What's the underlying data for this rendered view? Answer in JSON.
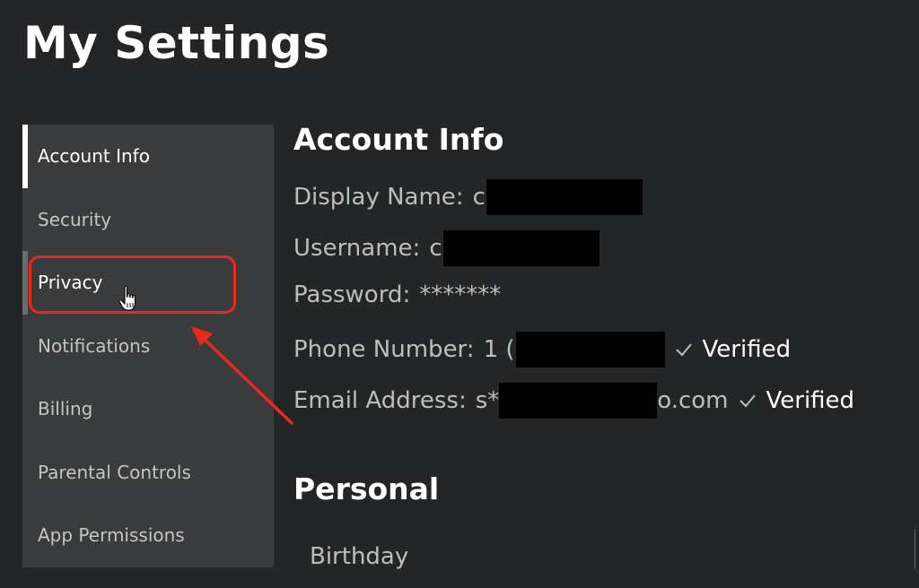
{
  "page": {
    "title": "My Settings"
  },
  "sidebar": {
    "items": [
      {
        "label": "Account Info"
      },
      {
        "label": "Security"
      },
      {
        "label": "Privacy"
      },
      {
        "label": "Notifications"
      },
      {
        "label": "Billing"
      },
      {
        "label": "Parental Controls"
      },
      {
        "label": "App Permissions"
      }
    ],
    "active": "Account Info",
    "hovered": "Privacy"
  },
  "account_info": {
    "title": "Account Info",
    "display_name": {
      "label": "Display Name:",
      "value": "c"
    },
    "username": {
      "label": "Username:",
      "value": "c"
    },
    "password": {
      "label": "Password:",
      "value": "*******"
    },
    "phone": {
      "label": "Phone Number:",
      "value": "1 (",
      "status": "Verified"
    },
    "email": {
      "label": "Email Address:",
      "value_prefix": "s*",
      "value_suffix": "o.com",
      "status": "Verified"
    }
  },
  "personal": {
    "title": "Personal",
    "birthday_label": "Birthday"
  },
  "colors": {
    "background": "#232527",
    "sidebar": "#393b3d",
    "annotation": "#e8291c",
    "text": "#bdbebe",
    "heading": "#ffffff"
  },
  "icons": {
    "cursor": "hand-pointer-icon",
    "check": "checkmark-icon",
    "annotation_arrow": "red-arrow-icon"
  }
}
